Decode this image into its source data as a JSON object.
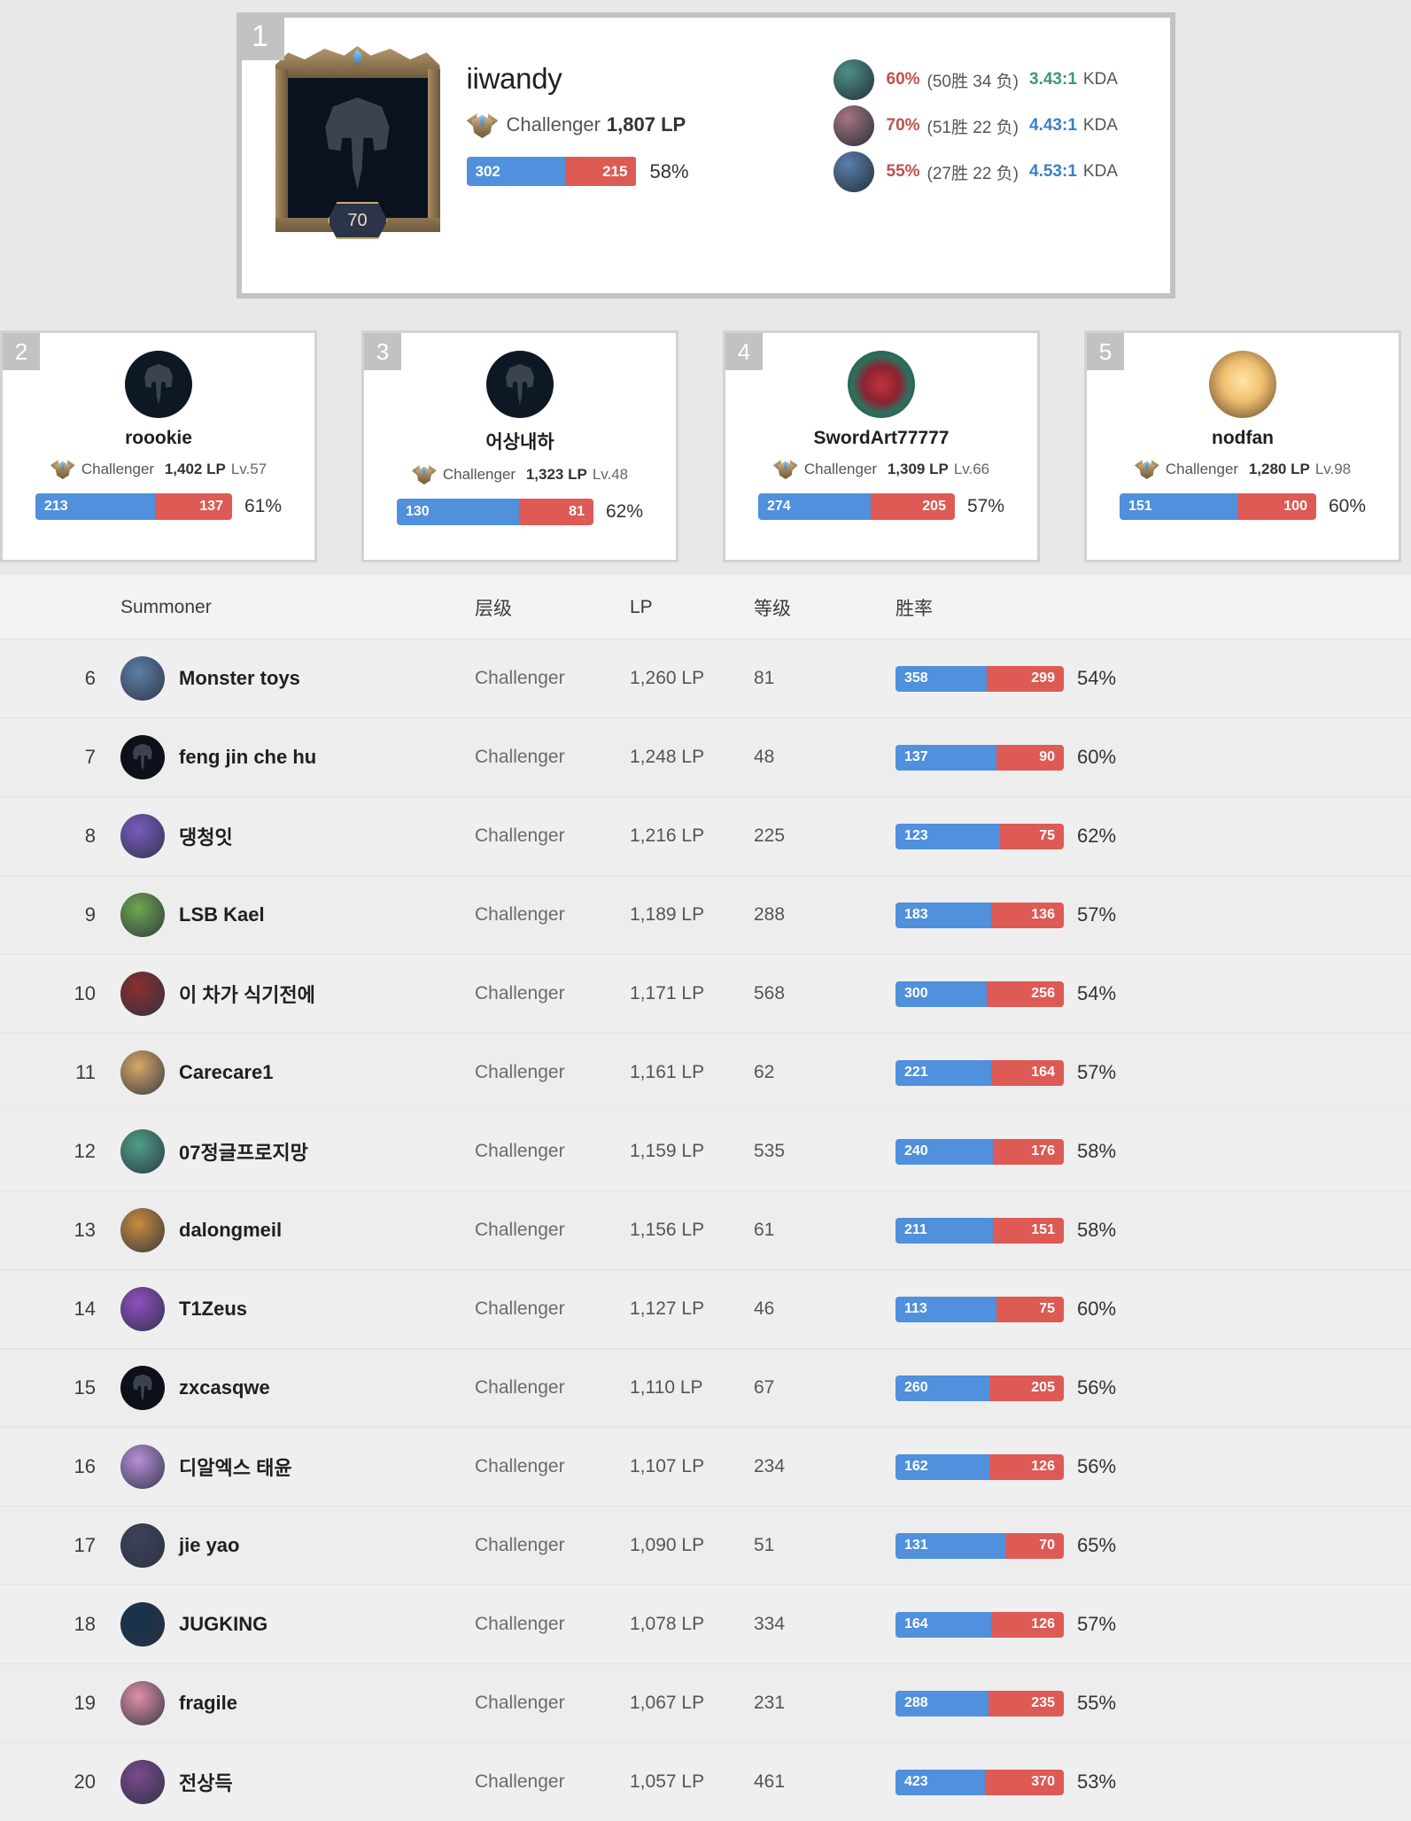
{
  "hero": {
    "rank": "1",
    "name": "iiwandy",
    "tier": "Challenger",
    "lp": "1,807 LP",
    "level": "70",
    "wins": "302",
    "losses": "215",
    "winrate": "58%",
    "win_pct_width": 58,
    "champions": [
      {
        "winrate": "60%",
        "record": "(50胜 34 负)",
        "kda": "3.43:1",
        "kda_label": "KDA",
        "kda_color": "#3c9a6e",
        "avatar_color": "#4e8f86"
      },
      {
        "winrate": "70%",
        "record": "(51胜 22 负)",
        "kda": "4.43:1",
        "kda_label": "KDA",
        "kda_color": "#3b7fc4",
        "avatar_color": "#a7757f"
      },
      {
        "winrate": "55%",
        "record": "(27胜 22 负)",
        "kda": "4.53:1",
        "kda_label": "KDA",
        "kda_color": "#3b7fc4",
        "avatar_color": "#5b7fae"
      }
    ]
  },
  "top_cards": [
    {
      "rank": "2",
      "name": "roookie",
      "tier": "Challenger",
      "lp": "1,402 LP",
      "level": "Lv.57",
      "wins": "213",
      "losses": "137",
      "winrate": "61%",
      "win_pct_width": 61,
      "avatar_color": "#0d1824",
      "avatar_kind": "helm"
    },
    {
      "rank": "3",
      "name": "어상내하",
      "tier": "Challenger",
      "lp": "1,323 LP",
      "level": "Lv.48",
      "wins": "130",
      "losses": "81",
      "winrate": "62%",
      "win_pct_width": 62,
      "avatar_color": "#0d1824",
      "avatar_kind": "helm"
    },
    {
      "rank": "4",
      "name": "SwordArt77777",
      "tier": "Challenger",
      "lp": "1,309 LP",
      "level": "Lv.66",
      "wins": "274",
      "losses": "205",
      "winrate": "57%",
      "win_pct_width": 57,
      "avatar_color": "#2f6f5e",
      "avatar_kind": "rose"
    },
    {
      "rank": "5",
      "name": "nodfan",
      "tier": "Challenger",
      "lp": "1,280 LP",
      "level": "Lv.98",
      "wins": "151",
      "losses": "100",
      "winrate": "60%",
      "win_pct_width": 60,
      "avatar_color": "#5a3a28",
      "avatar_kind": "lotus"
    }
  ],
  "table": {
    "headers": {
      "rank": "",
      "summoner": "Summoner",
      "tier": "层级",
      "lp": "LP",
      "level": "等级",
      "winrate": "胜率"
    },
    "rows": [
      {
        "rank": "6",
        "name": "Monster toys",
        "tier": "Challenger",
        "lp": "1,260 LP",
        "level": "81",
        "wins": "358",
        "losses": "299",
        "winrate": "54%",
        "win_pct_width": 54,
        "avatar_color": "#5d7fa8"
      },
      {
        "rank": "7",
        "name": "feng jin che hu",
        "tier": "Challenger",
        "lp": "1,248 LP",
        "level": "48",
        "wins": "137",
        "losses": "90",
        "winrate": "60%",
        "win_pct_width": 60,
        "avatar_color": "#0d1018"
      },
      {
        "rank": "8",
        "name": "댕청잇",
        "tier": "Challenger",
        "lp": "1,216 LP",
        "level": "225",
        "wins": "123",
        "losses": "75",
        "winrate": "62%",
        "win_pct_width": 62,
        "avatar_color": "#7a5bbf"
      },
      {
        "rank": "9",
        "name": "LSB Kael",
        "tier": "Challenger",
        "lp": "1,189 LP",
        "level": "288",
        "wins": "183",
        "losses": "136",
        "winrate": "57%",
        "win_pct_width": 57,
        "avatar_color": "#6ea84e"
      },
      {
        "rank": "10",
        "name": "이 차가 식기전에",
        "tier": "Challenger",
        "lp": "1,171 LP",
        "level": "568",
        "wins": "300",
        "losses": "256",
        "winrate": "54%",
        "win_pct_width": 54,
        "avatar_color": "#8c2f2f"
      },
      {
        "rank": "11",
        "name": "Carecare1",
        "tier": "Challenger",
        "lp": "1,161 LP",
        "level": "62",
        "wins": "221",
        "losses": "164",
        "winrate": "57%",
        "win_pct_width": 57,
        "avatar_color": "#d8a867"
      },
      {
        "rank": "12",
        "name": "07정글프로지망",
        "tier": "Challenger",
        "lp": "1,159 LP",
        "level": "535",
        "wins": "240",
        "losses": "176",
        "winrate": "58%",
        "win_pct_width": 58,
        "avatar_color": "#4f9f86"
      },
      {
        "rank": "13",
        "name": "dalongmeil",
        "tier": "Challenger",
        "lp": "1,156 LP",
        "level": "61",
        "wins": "211",
        "losses": "151",
        "winrate": "58%",
        "win_pct_width": 58,
        "avatar_color": "#c98c3c"
      },
      {
        "rank": "14",
        "name": "T1Zeus",
        "tier": "Challenger",
        "lp": "1,127 LP",
        "level": "46",
        "wins": "113",
        "losses": "75",
        "winrate": "60%",
        "win_pct_width": 60,
        "avatar_color": "#8f4fbf"
      },
      {
        "rank": "15",
        "name": "zxcasqwe",
        "tier": "Challenger",
        "lp": "1,110 LP",
        "level": "67",
        "wins": "260",
        "losses": "205",
        "winrate": "56%",
        "win_pct_width": 56,
        "avatar_color": "#0d1018"
      },
      {
        "rank": "16",
        "name": "디알엑스 태윤",
        "tier": "Challenger",
        "lp": "1,107 LP",
        "level": "234",
        "wins": "162",
        "losses": "126",
        "winrate": "56%",
        "win_pct_width": 56,
        "avatar_color": "#b78fd8"
      },
      {
        "rank": "17",
        "name": "jie yao",
        "tier": "Challenger",
        "lp": "1,090 LP",
        "level": "51",
        "wins": "131",
        "losses": "70",
        "winrate": "65%",
        "win_pct_width": 65,
        "avatar_color": "#3f4257"
      },
      {
        "rank": "18",
        "name": "JUGKING",
        "tier": "Challenger",
        "lp": "1,078 LP",
        "level": "334",
        "wins": "164",
        "losses": "126",
        "winrate": "57%",
        "win_pct_width": 57,
        "avatar_color": "#15344f"
      },
      {
        "rank": "19",
        "name": "fragile",
        "tier": "Challenger",
        "lp": "1,067 LP",
        "level": "231",
        "wins": "288",
        "losses": "235",
        "winrate": "55%",
        "win_pct_width": 55,
        "avatar_color": "#e08fa8"
      },
      {
        "rank": "20",
        "name": "전상득",
        "tier": "Challenger",
        "lp": "1,057 LP",
        "level": "461",
        "wins": "423",
        "losses": "370",
        "winrate": "53%",
        "win_pct_width": 53,
        "avatar_color": "#7a4a8f"
      }
    ]
  },
  "colors": {
    "win_blue": "#5090dc",
    "loss_red": "#dd5a55",
    "rank_badge": "#c2c2c2",
    "page_bg": "#e8e8e8"
  }
}
